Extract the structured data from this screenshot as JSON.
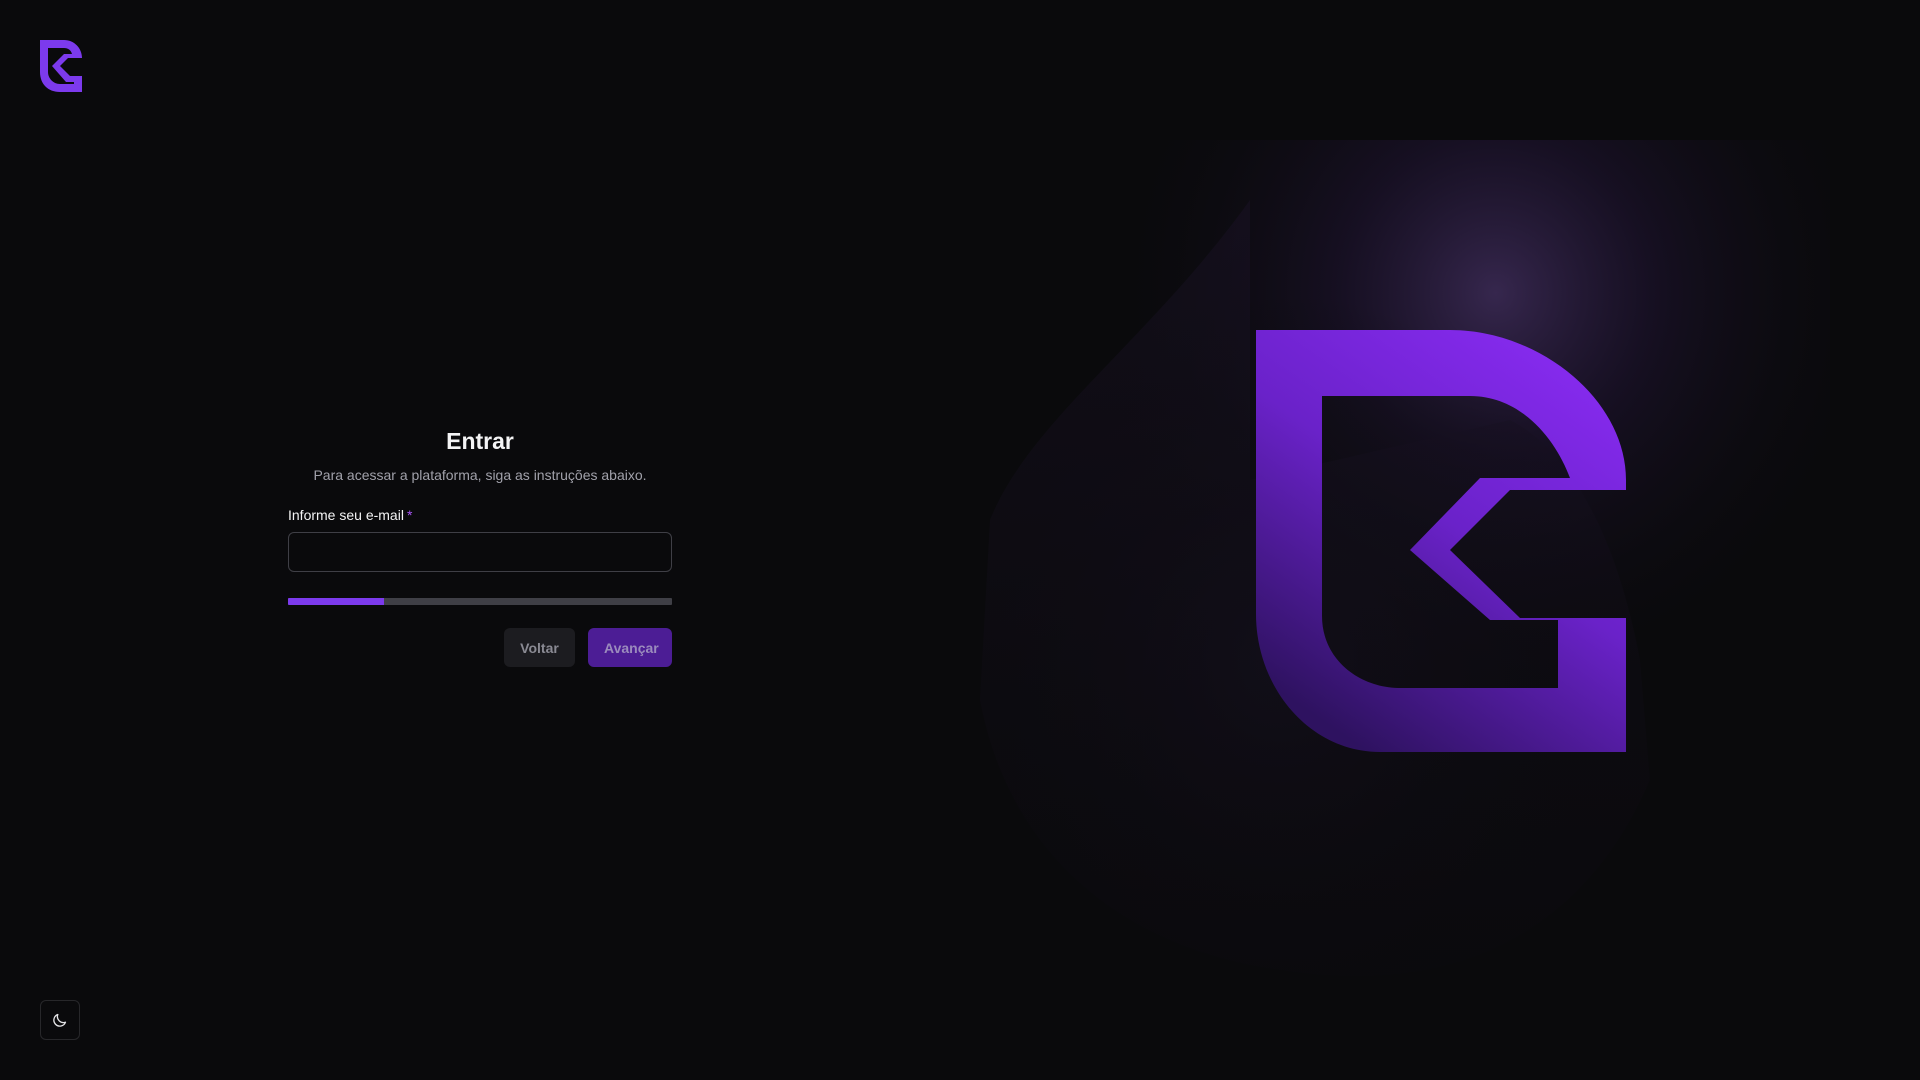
{
  "brand": {
    "accent": "#7c3aed",
    "logo_icon": "brand-logo-icon"
  },
  "login": {
    "title": "Entrar",
    "subtitle": "Para acessar a plataforma, siga as instruções abaixo.",
    "email_label": "Informe seu e-mail",
    "email_required_mark": "*",
    "email_value": "",
    "email_placeholder": "",
    "progress_percent": 25,
    "back_label": "Voltar",
    "next_label": "Avançar"
  },
  "footer": {
    "theme_toggle_icon": "moon-icon"
  }
}
